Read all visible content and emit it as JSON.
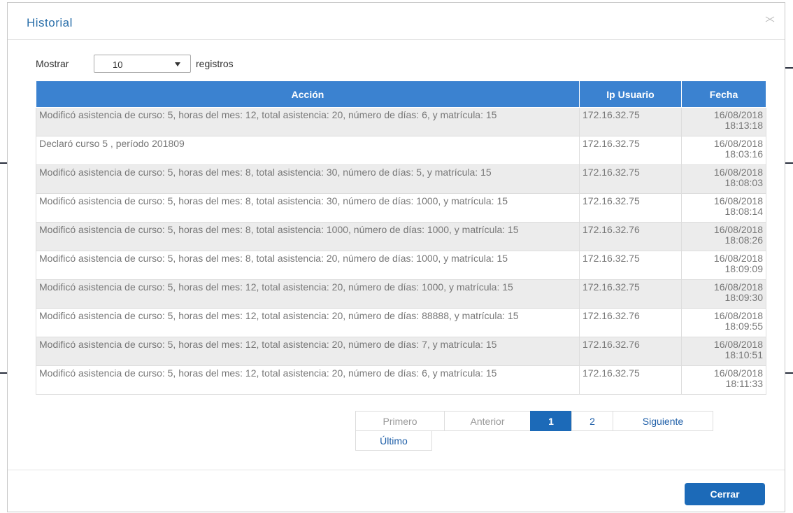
{
  "modal": {
    "title": "Historial",
    "close_icon": "close-icon"
  },
  "length": {
    "prefix": "Mostrar",
    "value": "10",
    "suffix": "registros"
  },
  "table": {
    "headers": [
      "Acción",
      "Ip Usuario",
      "Fecha"
    ],
    "rows": [
      {
        "accion": "Modificó asistencia de curso: 5, horas del mes: 12, total asistencia: 20, número de días: 6, y matrícula: 15",
        "ip": "172.16.32.75",
        "fecha": "16/08/2018 18:13:18"
      },
      {
        "accion": "Declaró curso 5 , período 201809",
        "ip": "172.16.32.75",
        "fecha": "16/08/2018 18:03:16"
      },
      {
        "accion": "Modificó asistencia de curso: 5, horas del mes: 8, total asistencia: 30, número de días: 5, y matrícula: 15",
        "ip": "172.16.32.75",
        "fecha": "16/08/2018 18:08:03"
      },
      {
        "accion": "Modificó asistencia de curso: 5, horas del mes: 8, total asistencia: 30, número de días: 1000, y matrícula: 15",
        "ip": "172.16.32.75",
        "fecha": "16/08/2018 18:08:14"
      },
      {
        "accion": "Modificó asistencia de curso: 5, horas del mes: 8, total asistencia: 1000, número de días: 1000, y matrícula: 15",
        "ip": "172.16.32.76",
        "fecha": "16/08/2018 18:08:26"
      },
      {
        "accion": "Modificó asistencia de curso: 5, horas del mes: 8, total asistencia: 20, número de días: 1000, y matrícula: 15",
        "ip": "172.16.32.75",
        "fecha": "16/08/2018 18:09:09"
      },
      {
        "accion": "Modificó asistencia de curso: 5, horas del mes: 12, total asistencia: 20, número de días: 1000, y matrícula: 15",
        "ip": "172.16.32.75",
        "fecha": "16/08/2018 18:09:30"
      },
      {
        "accion": "Modificó asistencia de curso: 5, horas del mes: 12, total asistencia: 20, número de días: 88888, y matrícula: 15",
        "ip": "172.16.32.76",
        "fecha": "16/08/2018 18:09:55"
      },
      {
        "accion": "Modificó asistencia de curso: 5, horas del mes: 12, total asistencia: 20, número de días: 7, y matrícula: 15",
        "ip": "172.16.32.76",
        "fecha": "16/08/2018 18:10:51"
      },
      {
        "accion": "Modificó asistencia de curso: 5, horas del mes: 12, total asistencia: 20, número de días: 6, y matrícula: 15",
        "ip": "172.16.32.75",
        "fecha": "16/08/2018 18:11:33"
      }
    ]
  },
  "pagination": {
    "first": "Primero",
    "previous": "Anterior",
    "page1": "1",
    "page2": "2",
    "next": "Siguiente",
    "last": "Último"
  },
  "footer": {
    "close_label": "Cerrar"
  },
  "colors": {
    "header_bg": "#3b82d0",
    "accent": "#1c6ab8",
    "title": "#2a6faa"
  }
}
